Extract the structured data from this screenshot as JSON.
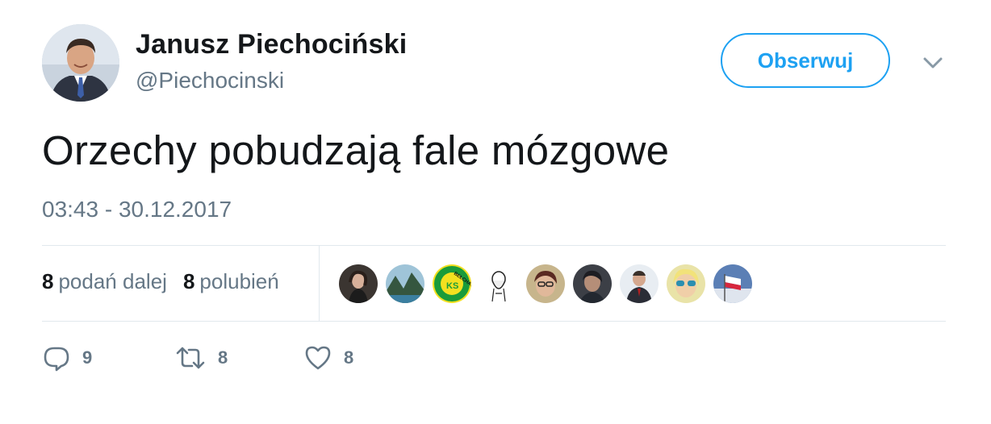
{
  "author": {
    "display_name": "Janusz Piechociński",
    "handle": "@Piechocinski",
    "avatar_icon": "profile-photo"
  },
  "header": {
    "follow_label": "Obserwuj",
    "menu_icon": "chevron-down-icon"
  },
  "tweet": {
    "text": "Orzechy pobudzają fale mózgowe",
    "timestamp": "03:43 - 30.12.2017"
  },
  "stats": {
    "retweets_count": "8",
    "retweets_label": "podań dalej",
    "likes_count": "8",
    "likes_label": "polubień"
  },
  "likers": [
    {
      "name": "liker-avatar-1"
    },
    {
      "name": "liker-avatar-2"
    },
    {
      "name": "liker-avatar-3"
    },
    {
      "name": "liker-avatar-4"
    },
    {
      "name": "liker-avatar-5"
    },
    {
      "name": "liker-avatar-6"
    },
    {
      "name": "liker-avatar-7"
    },
    {
      "name": "liker-avatar-8"
    },
    {
      "name": "liker-avatar-9"
    }
  ],
  "liker_badge_text": "BEŁCHATÓW",
  "liker_badge_letters": "KS",
  "actions": {
    "reply_count": "9",
    "retweet_count": "8",
    "like_count": "8"
  },
  "colors": {
    "accent": "#1da1f2",
    "text": "#14171a",
    "muted": "#657786",
    "divider": "#e1e8ed"
  }
}
